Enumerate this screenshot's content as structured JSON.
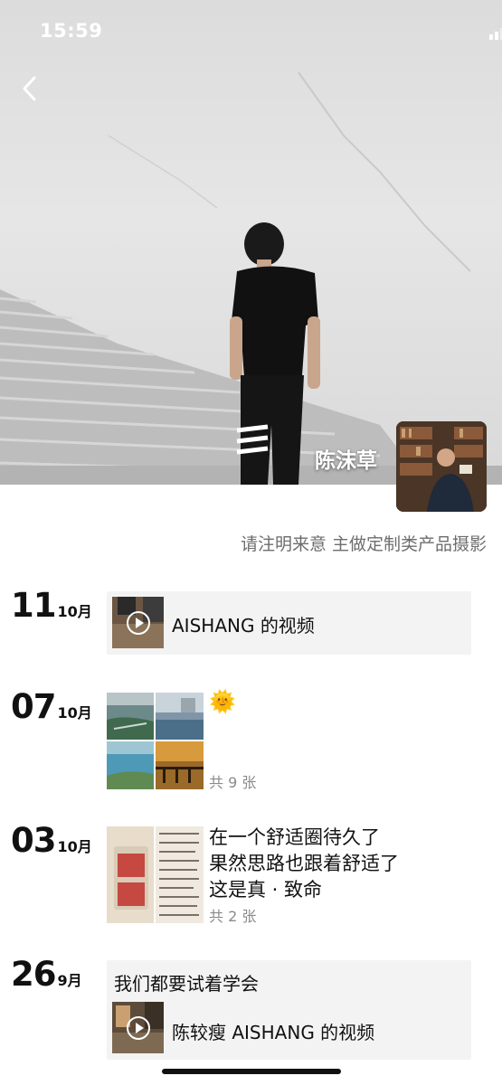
{
  "status_bar": {
    "time": "15:59"
  },
  "profile": {
    "name": "陈沫草",
    "signature": "请注明来意 主做定制类产品摄影"
  },
  "posts": [
    {
      "day": "11",
      "month": "10月",
      "type": "video",
      "title": "AISHANG 的视频"
    },
    {
      "day": "07",
      "month": "10月",
      "type": "photos",
      "text": "🌞",
      "count": "共 9 张"
    },
    {
      "day": "03",
      "month": "10月",
      "type": "photos",
      "lines": [
        "在一个舒适圈待久了",
        "果然思路也跟着舒适了",
        "这是真 · 致命"
      ],
      "count": "共 2 张"
    },
    {
      "day": "26",
      "month": "9月",
      "type": "shared_video",
      "text": "我们都要试着学会",
      "title": "陈较瘦 AISHANG 的视频"
    }
  ]
}
